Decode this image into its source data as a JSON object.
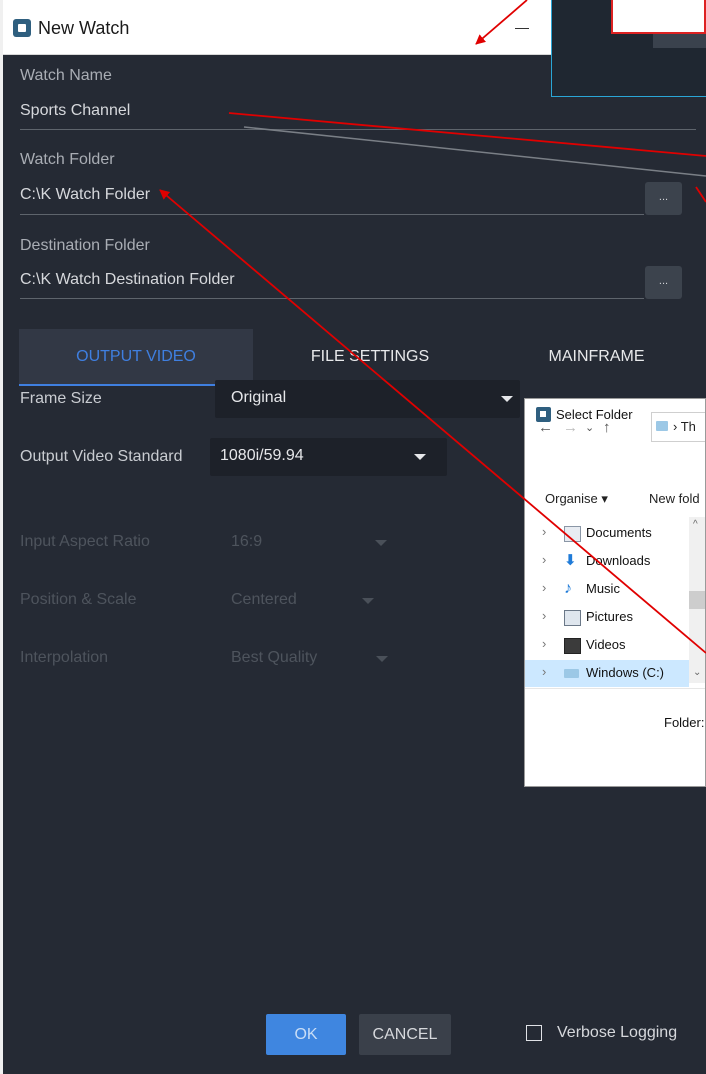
{
  "window": {
    "title": "New Watch",
    "minimize_glyph": "—"
  },
  "form": {
    "watch_name_label": "Watch Name",
    "watch_name_value": "Sports Channel",
    "watch_folder_label": "Watch Folder",
    "watch_folder_value": "C:\\K Watch Folder",
    "destination_label": "Destination Folder",
    "destination_value": "C:\\K Watch Destination Folder",
    "browse_label": "..."
  },
  "tabs": [
    {
      "label": "OUTPUT VIDEO",
      "active": true
    },
    {
      "label": "FILE SETTINGS",
      "active": false
    },
    {
      "label": "MAINFRAME",
      "active": false
    }
  ],
  "settings": [
    {
      "label": "Frame Size",
      "value": "Original",
      "enabled": true
    },
    {
      "label": "Output Video Standard",
      "value": "1080i/59.94",
      "enabled": true
    },
    {
      "label": "Input Aspect Ratio",
      "value": "16:9",
      "enabled": false
    },
    {
      "label": "Position & Scale",
      "value": "Centered",
      "enabled": false
    },
    {
      "label": "Interpolation",
      "value": "Best Quality",
      "enabled": false
    }
  ],
  "footer": {
    "ok": "OK",
    "cancel": "CANCEL",
    "verbose": "Verbose Logging",
    "verbose_checked": false
  },
  "select_folder_dialog": {
    "title": "Select Folder",
    "address_text": "Th",
    "organise": "Organise ▾",
    "new_folder": "New fold",
    "tree": [
      {
        "label": "Documents",
        "icon": "documents-icon",
        "selected": false
      },
      {
        "label": "Downloads",
        "icon": "downloads-icon",
        "selected": false
      },
      {
        "label": "Music",
        "icon": "music-icon",
        "selected": false
      },
      {
        "label": "Pictures",
        "icon": "pictures-icon",
        "selected": false
      },
      {
        "label": "Videos",
        "icon": "videos-icon",
        "selected": false
      },
      {
        "label": "Windows (C:)",
        "icon": "drive-icon",
        "selected": true
      }
    ],
    "folder_label": "Folder:"
  },
  "colors": {
    "panel_bg": "#252a34",
    "accent_blue": "#3f86e0",
    "annotation_red": "#e00000"
  }
}
